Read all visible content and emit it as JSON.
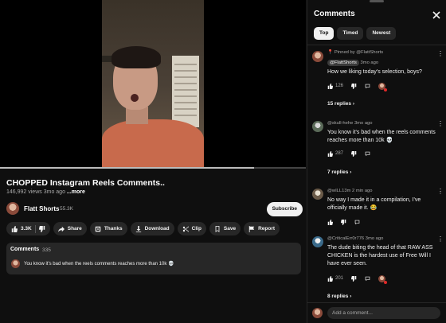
{
  "video": {
    "progress_percent": 83,
    "title": "CHOPPED Instagram Reels Comments..",
    "views": "146,992 views",
    "age": "3mo ago",
    "more_label": "...more"
  },
  "channel": {
    "name": "Flatt Shorts",
    "subscribers": "55.3K",
    "subscribe_label": "Subscribe"
  },
  "actions": {
    "likes": "3.3K",
    "share": "Share",
    "thanks": "Thanks",
    "download": "Download",
    "clip": "Clip",
    "save": "Save",
    "report": "Report"
  },
  "comments_card": {
    "title": "Comments",
    "count": "335",
    "preview": "You know it's bad when the reels comments reaches more than 10k 💀"
  },
  "panel": {
    "title": "Comments",
    "tabs": [
      "Top",
      "Timed",
      "Newest"
    ],
    "add_placeholder": "Add a comment..."
  },
  "comments": [
    {
      "pinned_label": "Pinned by @FlattShorts",
      "author": "@FlattShorts",
      "age": "3mo ago",
      "text": "How we liking today's selection, boys?",
      "likes": "126",
      "replies": "15 replies"
    },
    {
      "author": "@skull-hehe",
      "age": "3mo ago",
      "text": "You know it's bad when the reels comments reaches more than 10k 💀",
      "likes": "287",
      "replies": "7 replies"
    },
    {
      "author": "@wILL13m",
      "age": "2 min ago",
      "text": "No way I made it in a compilation, I've officially made it. 😂",
      "likes": "",
      "replies": ""
    },
    {
      "author": "@CriticalErr0r776",
      "age": "3mo ago",
      "text": "The dude biting the head of that RAW ASS CHICKEN is the hardest use of Free Will I have ever seen.",
      "likes": "201",
      "replies": "8 replies"
    }
  ],
  "colors": {
    "background": "#0f0f0f",
    "surface": "#272727",
    "text": "#f1f1f1",
    "muted": "#aaaaaa"
  }
}
